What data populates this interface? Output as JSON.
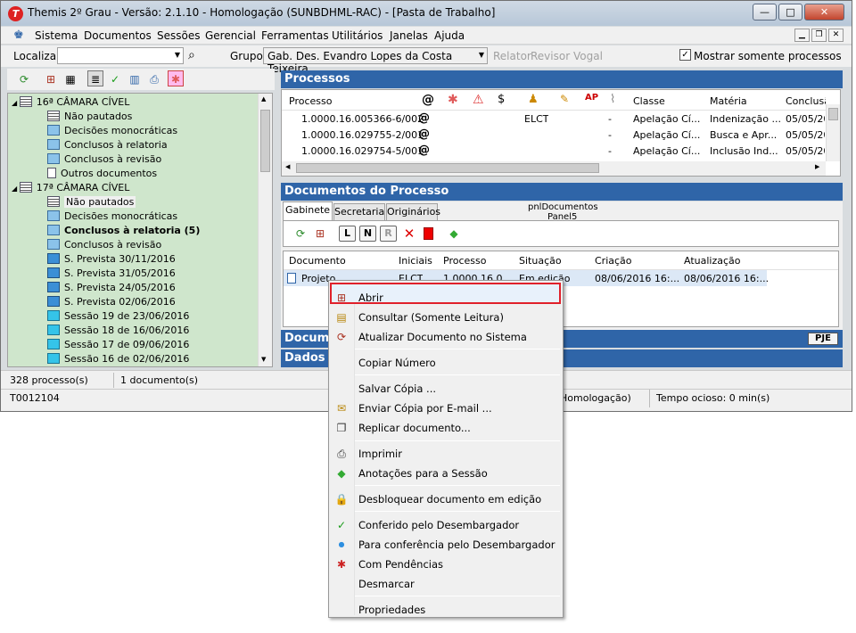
{
  "window": {
    "title": "Themis 2º Grau - Versão: 2.1.10 - Homologação (SUNBDHML-RAC) - [Pasta de Trabalho]",
    "logo_letter": "T",
    "min": "—",
    "max": "□",
    "close": "✕"
  },
  "menu": [
    "Sistema",
    "Documentos",
    "Sessões",
    "Gerencial",
    "Ferramentas",
    "Utilitários",
    "Janelas",
    "Ajuda"
  ],
  "toolbar": {
    "localizar_label": "Localizar:",
    "localizar_value": "",
    "grupo_label": "Grupo:",
    "grupo_value": "Gab. Des. Evandro Lopes da Costa Teixeira",
    "relator": "Relator",
    "revisor": "Revisor",
    "vogal": "Vogal",
    "mostrar_label": "Mostrar somente processos conclus"
  },
  "tree": [
    {
      "text": "16ª CÂMARA CÍVEL",
      "level": 0,
      "icon": "chamber"
    },
    {
      "text": "Não pautados",
      "level": 1,
      "icon": "grid"
    },
    {
      "text": "Decisões monocráticas",
      "level": 1,
      "icon": "dec"
    },
    {
      "text": "Conclusos à relatoria",
      "level": 1,
      "icon": "dec"
    },
    {
      "text": "Conclusos à revisão",
      "level": 1,
      "icon": "dec"
    },
    {
      "text": "Outros documentos",
      "level": 1,
      "icon": "doc"
    },
    {
      "text": "17ª CÂMARA CÍVEL",
      "level": 0,
      "icon": "chamber"
    },
    {
      "text": "Não pautados",
      "level": 1,
      "icon": "grid"
    },
    {
      "text": "Decisões monocráticas",
      "level": 1,
      "icon": "dec"
    },
    {
      "text": "Conclusos à relatoria (5)",
      "level": 1,
      "icon": "dec",
      "bold": true
    },
    {
      "text": "Conclusos à revisão",
      "level": 1,
      "icon": "dec"
    },
    {
      "text": "S. Prevista 30/11/2016",
      "level": 1,
      "icon": "sp"
    },
    {
      "text": "S. Prevista 31/05/2016",
      "level": 1,
      "icon": "sp"
    },
    {
      "text": "S. Prevista 24/05/2016",
      "level": 1,
      "icon": "sp"
    },
    {
      "text": "S. Prevista 02/06/2016",
      "level": 1,
      "icon": "sp"
    },
    {
      "text": "Sessão 19 de 23/06/2016",
      "level": 1,
      "icon": "ses"
    },
    {
      "text": "Sessão 18 de 16/06/2016",
      "level": 1,
      "icon": "ses"
    },
    {
      "text": "Sessão 17 de 09/06/2016",
      "level": 1,
      "icon": "ses"
    },
    {
      "text": "Sessão 16 de 02/06/2016",
      "level": 1,
      "icon": "ses"
    }
  ],
  "processos": {
    "title": "Processos",
    "columns": [
      "Processo",
      "Classe",
      "Matéria",
      "Conclusã"
    ],
    "rows": [
      {
        "processo": "1.0000.16.005366-6/002",
        "user": "ELCT",
        "dash": "-",
        "classe": "Apelação Cí...",
        "materia": "Indenização ...",
        "conclusao": "05/05/20"
      },
      {
        "processo": "1.0000.16.029755-2/001",
        "user": "",
        "dash": "-",
        "classe": "Apelação Cí...",
        "materia": "Busca e Apr...",
        "conclusao": "05/05/20"
      },
      {
        "processo": "1.0000.16.029754-5/001",
        "user": "",
        "dash": "-",
        "classe": "Apelação Cí...",
        "materia": "Inclusão Ind...",
        "conclusao": "05/05/20"
      }
    ]
  },
  "documentos": {
    "title": "Documentos do Processo",
    "tabs": [
      "Gabinete",
      "Secretaria",
      "Originários"
    ],
    "panel_label": "pnlDocumentos",
    "panel_label2": "Panel5",
    "buttons": [
      "L",
      "N",
      "R"
    ],
    "columns": [
      "Documento",
      "Iniciais",
      "Processo",
      "Situação",
      "Criação",
      "Atualização"
    ],
    "row": {
      "documento": "Projeto",
      "iniciais": "ELCT",
      "processo": "1.0000.16.0...",
      "situacao": "Em edição",
      "criacao": "08/06/2016 16:...",
      "atualizacao": "08/06/2016 16:..."
    },
    "bar2_title": "Docum",
    "pje": "PJE",
    "bar3_title": "Dados"
  },
  "status": {
    "processos": "328 processo(s)",
    "documentos": "1 documento(s)",
    "user": "T0012104",
    "env": "Homologação)",
    "idle": "Tempo ocioso: 0 min(s)"
  },
  "context_menu": [
    {
      "label": "Abrir",
      "icon": "open-icon",
      "glyph": "⊞"
    },
    {
      "label": "Consultar (Somente Leitura)",
      "icon": "view-icon",
      "glyph": "▤"
    },
    {
      "label": "Atualizar Documento no Sistema",
      "icon": "update-icon",
      "glyph": "⟳"
    },
    {
      "label": "Copiar Número",
      "icon": "",
      "glyph": ""
    },
    {
      "label": "Salvar Cópia ...",
      "icon": "",
      "glyph": ""
    },
    {
      "label": "Enviar Cópia por E-mail ...",
      "icon": "mail-icon",
      "glyph": "✉"
    },
    {
      "label": "Replicar documento...",
      "icon": "replicate-icon",
      "glyph": "❐"
    },
    {
      "label": "Imprimir",
      "icon": "print-icon",
      "glyph": "⎙"
    },
    {
      "label": "Anotações para a Sessão",
      "icon": "note-icon",
      "glyph": "◆"
    },
    {
      "label": "Desbloquear documento em edição",
      "icon": "lock-icon",
      "glyph": "🔒"
    },
    {
      "label": "Conferido pelo Desembargador",
      "icon": "check-icon",
      "glyph": "✓"
    },
    {
      "label": "Para conferência pelo Desembargador",
      "icon": "dot-icon",
      "glyph": "●"
    },
    {
      "label": "Com Pendências",
      "icon": "asterisk-icon",
      "glyph": "✱"
    },
    {
      "label": "Desmarcar",
      "icon": "",
      "glyph": ""
    },
    {
      "label": "Propriedades",
      "icon": "",
      "glyph": ""
    }
  ],
  "colors": {
    "header": "#2f65a8",
    "tree_bg": "#cfe6cc",
    "highlight_border": "#e0202a"
  }
}
